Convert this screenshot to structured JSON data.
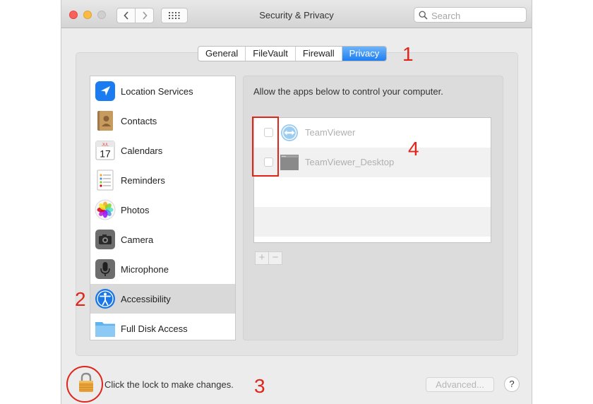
{
  "window": {
    "title": "Security & Privacy"
  },
  "search": {
    "placeholder": "Search",
    "value": ""
  },
  "tabs": [
    {
      "label": "General",
      "active": false
    },
    {
      "label": "FileVault",
      "active": false
    },
    {
      "label": "Firewall",
      "active": false
    },
    {
      "label": "Privacy",
      "active": true
    }
  ],
  "sidebar": {
    "selected": "Accessibility",
    "items": [
      {
        "label": "Location Services",
        "icon": "location-arrow-icon"
      },
      {
        "label": "Contacts",
        "icon": "contacts-book-icon"
      },
      {
        "label": "Calendars",
        "icon": "calendar-icon"
      },
      {
        "label": "Reminders",
        "icon": "reminders-list-icon"
      },
      {
        "label": "Photos",
        "icon": "photos-flower-icon"
      },
      {
        "label": "Camera",
        "icon": "camera-icon"
      },
      {
        "label": "Microphone",
        "icon": "microphone-icon"
      },
      {
        "label": "Accessibility",
        "icon": "accessibility-icon"
      },
      {
        "label": "Full Disk Access",
        "icon": "folder-icon"
      }
    ]
  },
  "calendar_icon": {
    "month": "JUL",
    "day": "17"
  },
  "panel": {
    "description": "Allow the apps below to control your computer.",
    "apps": [
      {
        "name": "TeamViewer",
        "checked": false,
        "icon": "teamviewer-icon"
      },
      {
        "name": "TeamViewer_Desktop",
        "checked": false,
        "icon": "teamviewer-desktop-icon"
      }
    ],
    "add_label": "+",
    "remove_label": "−"
  },
  "footer": {
    "lock_text": "Click the lock to make changes.",
    "advanced_label": "Advanced...",
    "help_label": "?"
  },
  "annotations": {
    "n1": "1",
    "n2": "2",
    "n3": "3",
    "n4": "4"
  },
  "colors": {
    "accent": "#1f7ef1",
    "annotation": "#e0251b"
  }
}
